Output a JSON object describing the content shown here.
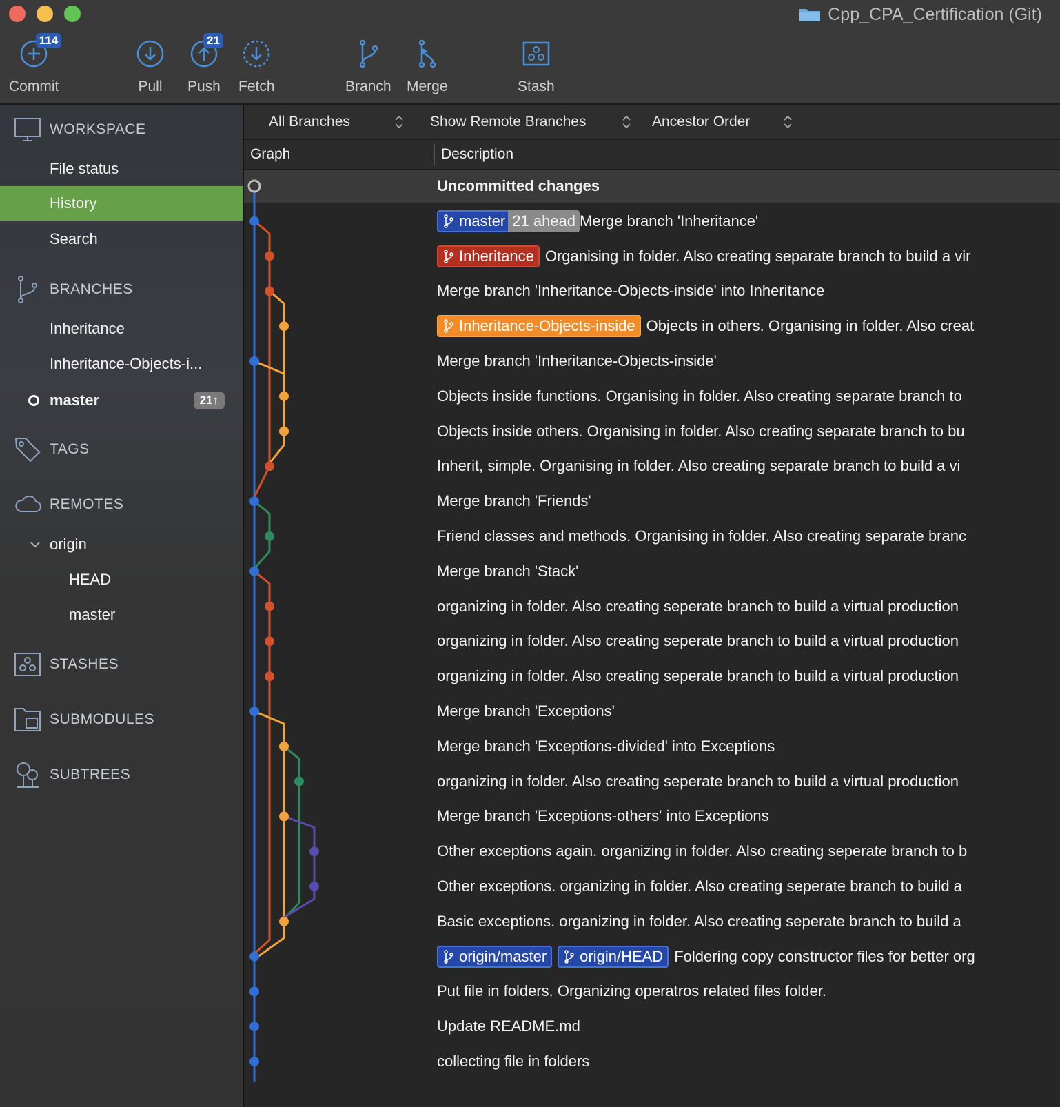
{
  "window": {
    "title": "Cpp_CPA_Certification (Git)"
  },
  "toolbar": {
    "commit": {
      "label": "Commit",
      "badge": "114"
    },
    "pull": {
      "label": "Pull"
    },
    "push": {
      "label": "Push",
      "badge": "21"
    },
    "fetch": {
      "label": "Fetch"
    },
    "branch": {
      "label": "Branch"
    },
    "merge": {
      "label": "Merge"
    },
    "stash": {
      "label": "Stash"
    }
  },
  "sidebar": {
    "workspace": "WORKSPACE",
    "file_status": "File status",
    "history": "History",
    "search": "Search",
    "branches": "BRANCHES",
    "branch_items": [
      "Inheritance",
      "Inheritance-Objects-i...",
      "master"
    ],
    "master_ahead": "21↑",
    "tags": "TAGS",
    "remotes": "REMOTES",
    "origin": "origin",
    "remote_items": [
      "HEAD",
      "master"
    ],
    "stashes": "STASHES",
    "submodules": "SUBMODULES",
    "subtrees": "SUBTREES"
  },
  "filters": {
    "branches": "All Branches",
    "remote": "Show Remote Branches",
    "order": "Ancestor Order"
  },
  "columns": {
    "graph": "Graph",
    "description": "Description"
  },
  "colors": {
    "master": "#2f6fd6",
    "inheritance": "#d4502a",
    "objects_inside": "#f4a33a",
    "friends": "#2f8a5e",
    "exceptions_others": "#5a4bb0",
    "active_sidebar": "#66a14a"
  },
  "commits": [
    {
      "message": "Uncommitted changes",
      "bold": true,
      "tags": []
    },
    {
      "message": "Merge branch 'Inheritance'",
      "tags": [
        {
          "label": "master",
          "style": "blue"
        },
        {
          "label": "21 ahead",
          "style": "ahead"
        }
      ]
    },
    {
      "message": "Organising in folder. Also creating separate branch to build a vir",
      "tags": [
        {
          "label": "Inheritance",
          "style": "red"
        }
      ]
    },
    {
      "message": "Merge branch 'Inheritance-Objects-inside' into Inheritance",
      "tags": []
    },
    {
      "message": "Objects in others. Organising in folder. Also creat",
      "tags": [
        {
          "label": "Inheritance-Objects-inside",
          "style": "orange"
        }
      ]
    },
    {
      "message": "Merge branch 'Inheritance-Objects-inside'",
      "tags": []
    },
    {
      "message": "Objects inside functions. Organising in folder. Also creating separate branch to",
      "tags": []
    },
    {
      "message": "Objects inside others. Organising in folder. Also creating separate branch to bu",
      "tags": []
    },
    {
      "message": "Inherit, simple. Organising in folder. Also creating separate branch to build a vi",
      "tags": []
    },
    {
      "message": "Merge branch 'Friends'",
      "tags": []
    },
    {
      "message": "Friend classes and methods. Organising in folder. Also creating separate branc",
      "tags": []
    },
    {
      "message": "Merge branch 'Stack'",
      "tags": []
    },
    {
      "message": "organizing in folder. Also creating seperate branch to build a virtual production",
      "tags": []
    },
    {
      "message": "organizing in folder. Also creating seperate branch to build a virtual production",
      "tags": []
    },
    {
      "message": "organizing in folder. Also creating seperate branch to build a virtual production",
      "tags": []
    },
    {
      "message": "Merge branch 'Exceptions'",
      "tags": []
    },
    {
      "message": "Merge branch 'Exceptions-divided' into Exceptions",
      "tags": []
    },
    {
      "message": "organizing in folder. Also creating seperate branch to build a virtual production",
      "tags": []
    },
    {
      "message": "Merge branch 'Exceptions-others' into Exceptions",
      "tags": []
    },
    {
      "message": "Other exceptions again. organizing in folder. Also creating seperate branch to b",
      "tags": []
    },
    {
      "message": "Other exceptions. organizing in folder. Also creating seperate branch to build a",
      "tags": []
    },
    {
      "message": "Basic exceptions. organizing in folder. Also creating seperate branch to build a",
      "tags": []
    },
    {
      "message": "Foldering copy constructor files for better org",
      "tags": [
        {
          "label": "origin/master",
          "style": "blue"
        },
        {
          "label": "origin/HEAD",
          "style": "blue"
        }
      ]
    },
    {
      "message": "Put file in folders. Organizing operatros related files folder.",
      "tags": []
    },
    {
      "message": "Update README.md",
      "tags": []
    },
    {
      "message": "collecting file in folders",
      "tags": []
    }
  ]
}
